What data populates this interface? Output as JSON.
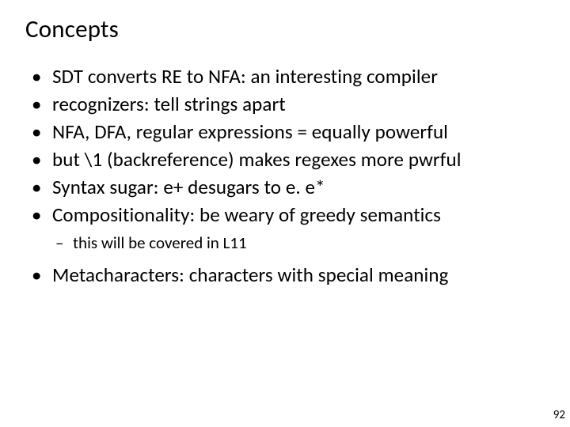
{
  "title": "Concepts",
  "bullets": [
    "SDT converts RE to NFA: an interesting compiler",
    "recognizers: tell strings apart",
    "NFA, DFA, regular expressions = equally powerful",
    "but \\1 (backreference) makes regexes more pwrful",
    "Syntax sugar: e+ desugars to e. e*",
    "Compositionality: be weary of greedy semantics"
  ],
  "sub_bullet": "this will be covered in L11",
  "last_bullet": "Metacharacters: characters with special meaning",
  "page_number": "92"
}
